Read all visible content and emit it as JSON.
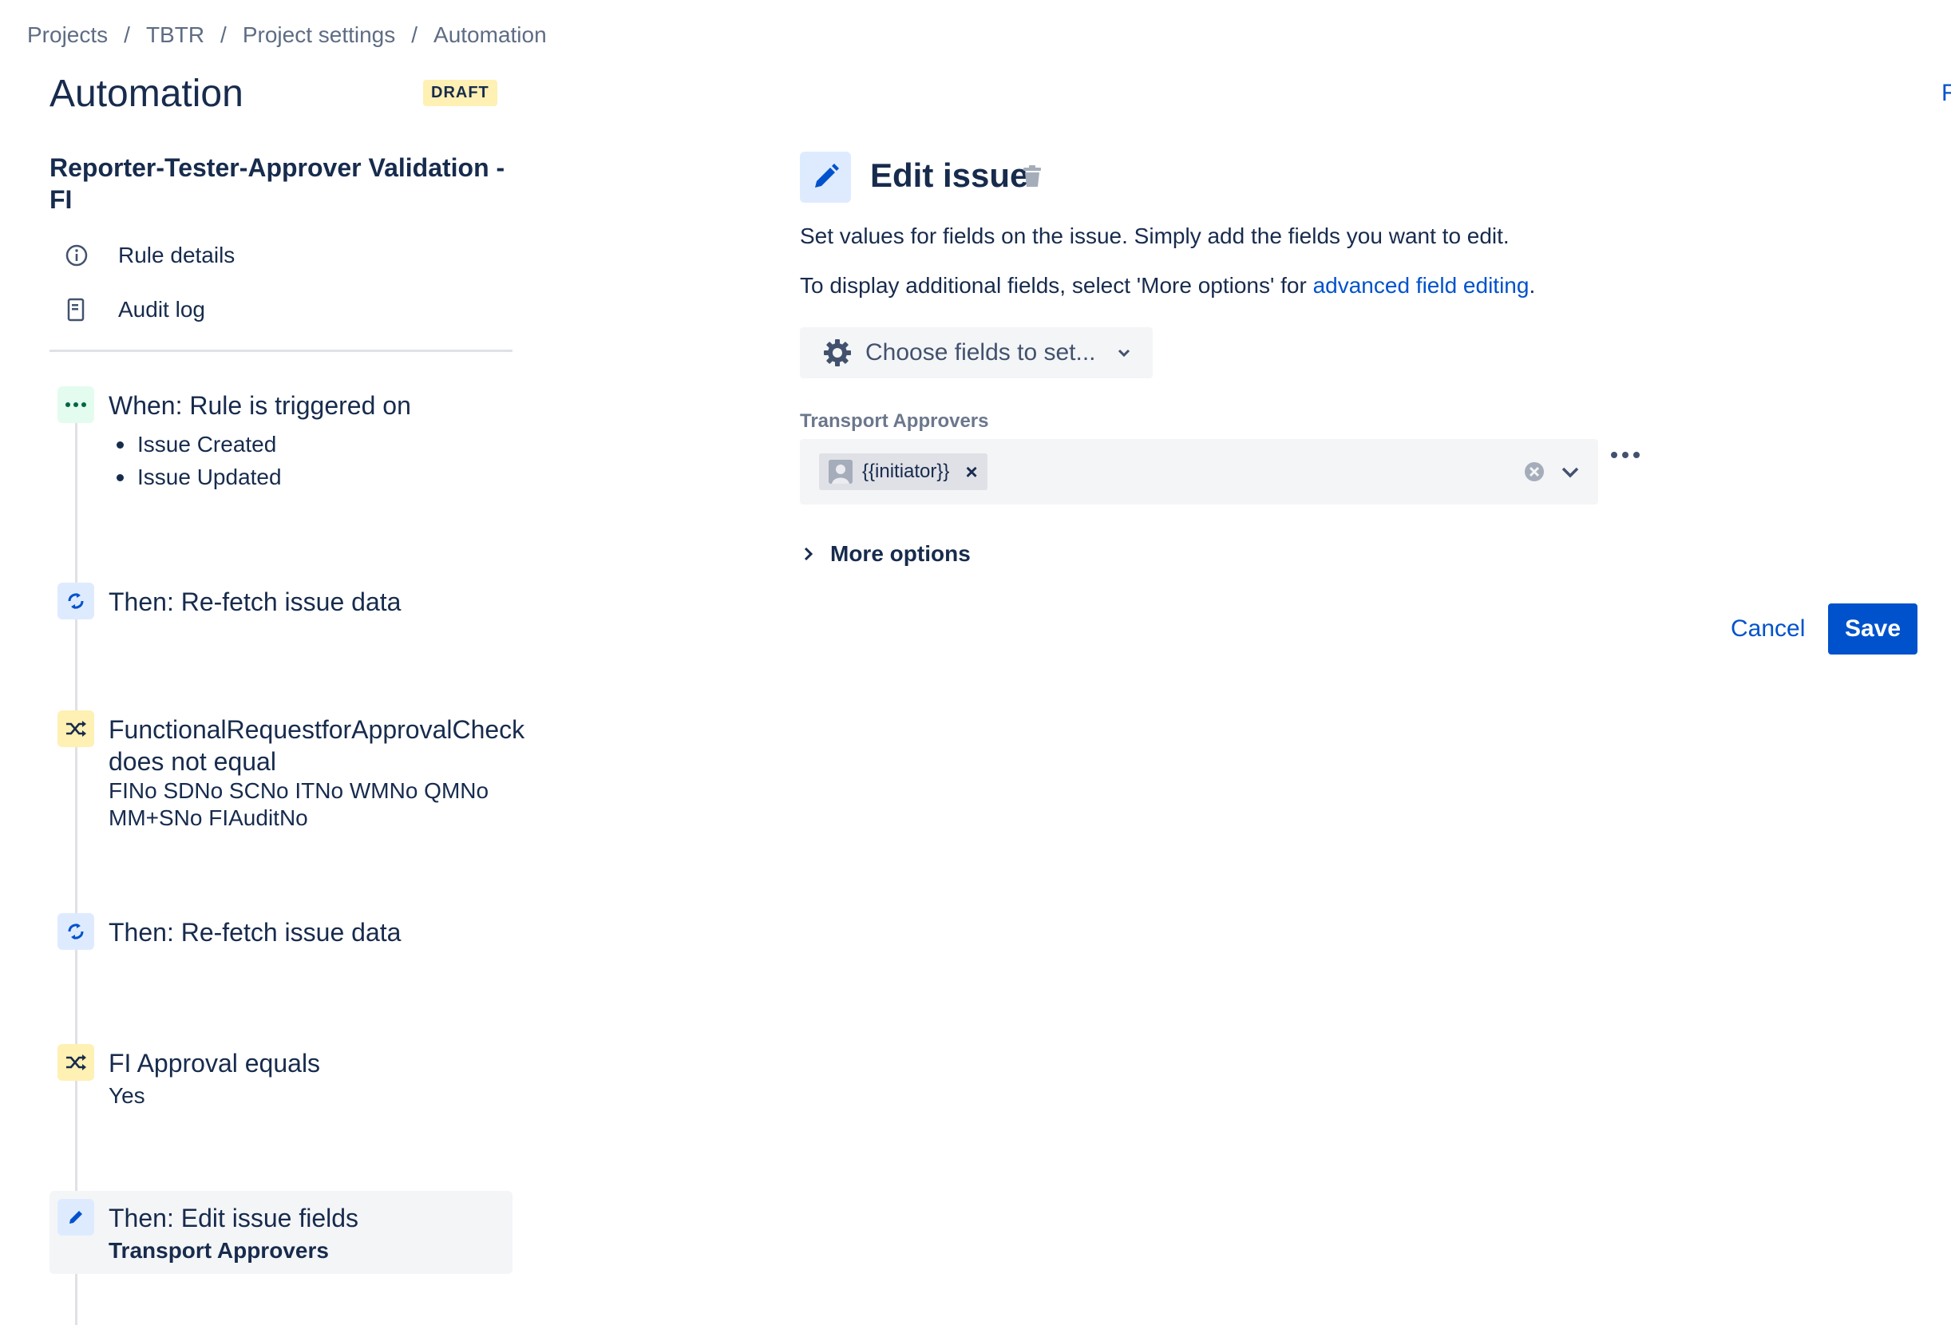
{
  "breadcrumb": [
    "Projects",
    "TBTR",
    "Project settings",
    "Automation"
  ],
  "breadcrumb_separator": "/",
  "header": {
    "title": "Automation",
    "badge": "DRAFT",
    "top_right_link": "R"
  },
  "rule": {
    "name": "Reporter-Tester-Approver Validation - FI",
    "links": [
      {
        "label": "Rule details",
        "icon": "info-icon"
      },
      {
        "label": "Audit log",
        "icon": "document-icon"
      }
    ]
  },
  "steps": [
    {
      "title": "When: Rule is triggered on",
      "icon": "more-horizontal-icon",
      "bullets": [
        "Issue Created",
        "Issue Updated"
      ]
    },
    {
      "title": "Then: Re-fetch issue data",
      "icon": "refresh-icon"
    },
    {
      "title": "FunctionalRequestforApprovalCheck does not equal",
      "subtitle": "FINo SDNo SCNo ITNo WMNo QMNo MM+SNo FIAuditNo",
      "icon": "shuffle-icon"
    },
    {
      "title": "Then: Re-fetch issue data",
      "icon": "refresh-icon"
    },
    {
      "title": "FI Approval equals",
      "subtitle": "Yes",
      "icon": "shuffle-icon"
    },
    {
      "title": "Then: Edit issue fields",
      "subtitle": "Transport Approvers",
      "icon": "pencil-icon",
      "selected": true
    }
  ],
  "editor": {
    "title": "Edit issue",
    "description": "Set values for fields on the issue. Simply add the fields you want to edit.",
    "description2_prefix": "To display additional fields, select 'More options' for ",
    "description2_link": "advanced field editing",
    "description2_suffix": ".",
    "choose_fields_label": "Choose fields to set...",
    "field": {
      "label": "Transport Approvers",
      "tag_value": "{{initiator}}",
      "tag_remove": "×"
    },
    "more_options_label": "More options",
    "cancel_label": "Cancel",
    "save_label": "Save"
  },
  "colors": {
    "accent": "#0052cc",
    "text": "#172b4d",
    "muted": "#5e6c84",
    "badge_bg": "#fff0b3"
  }
}
